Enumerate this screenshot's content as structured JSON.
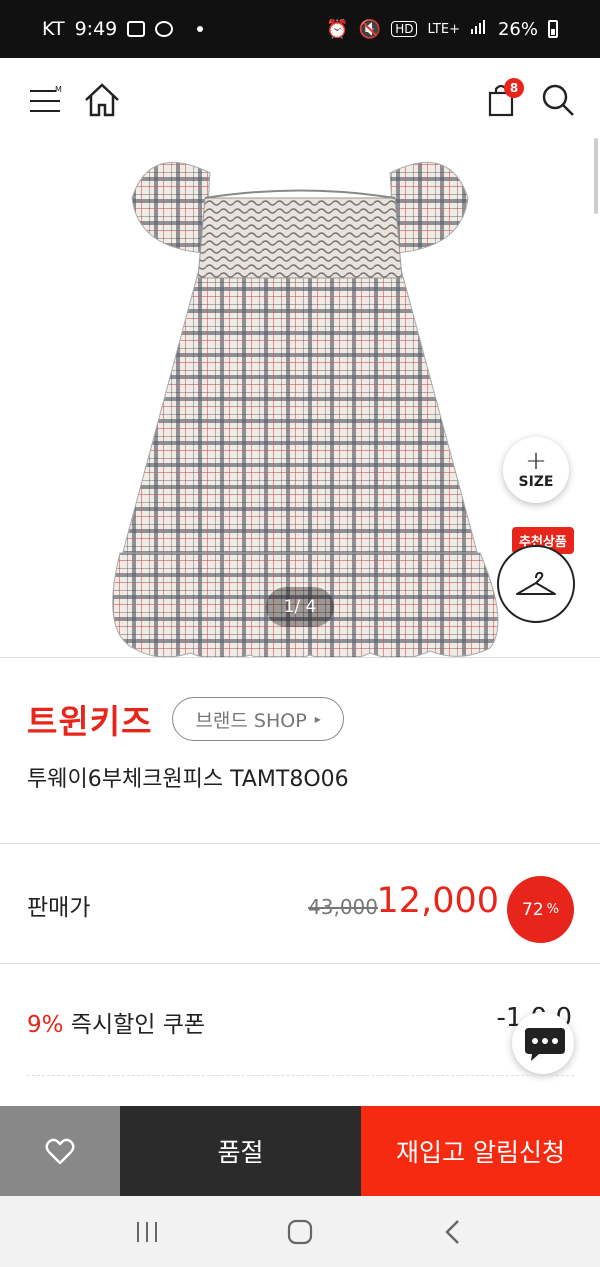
{
  "status_bar": {
    "carrier": "KT",
    "time": "9:49",
    "network": "LTE+",
    "hd": "HD",
    "battery": "26%"
  },
  "header": {
    "cart_count": "8"
  },
  "gallery": {
    "pager": "1/ 4",
    "size_plus": "+",
    "size_label": "SIZE",
    "recommend_label": "추천상품"
  },
  "product": {
    "brand": "트윈키즈",
    "brand_shop": "브랜드 SHOP",
    "brand_shop_arrow": "▸",
    "name": "투웨이6부체크원피스 TAMT8O06"
  },
  "price": {
    "label": "판매가",
    "original": "43,000",
    "sale": "12,000",
    "discount": "72",
    "discount_unit": "%"
  },
  "coupon": {
    "percent": "9%",
    "label": " 즉시할인 쿠폰",
    "value": "-1,0 0"
  },
  "actions": {
    "soldout": "품절",
    "restock": "재입고 알림신청"
  },
  "colors": {
    "accent": "#e8251a",
    "restock_bg": "#f62a10",
    "soldout_bg": "#2b2b2b",
    "wish_bg": "#888888"
  }
}
